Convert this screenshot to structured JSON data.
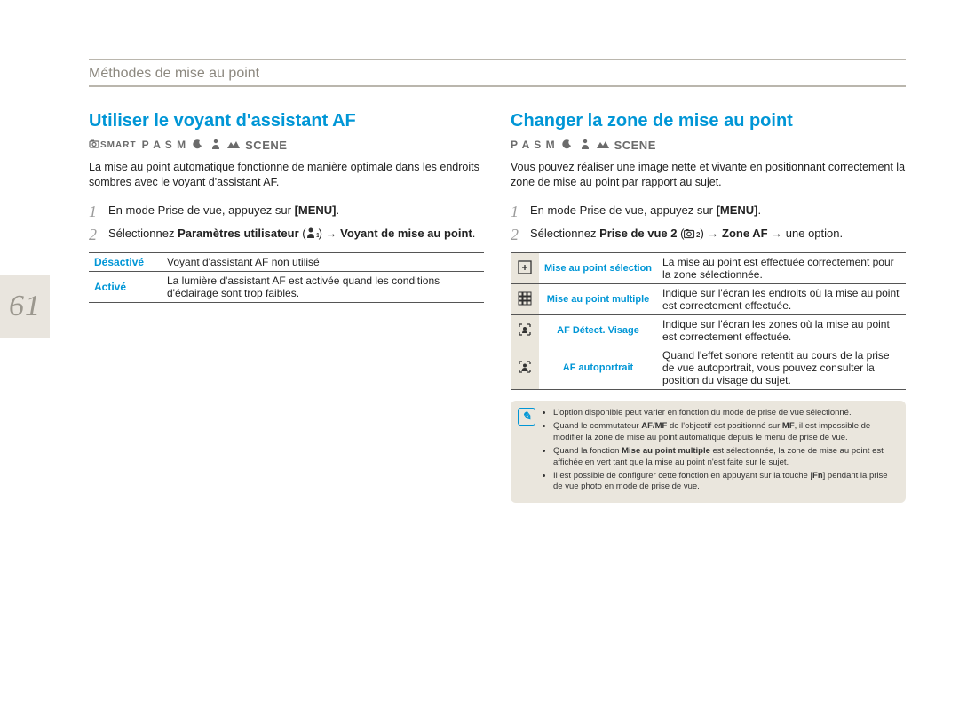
{
  "pageNumber": "61",
  "header": "Méthodes de mise au point",
  "left": {
    "title": "Utiliser le voyant d'assistant AF",
    "modeSmart": "SMART",
    "modePASM": "P A S M",
    "modeScene": "SCENE",
    "intro": "La mise au point automatique fonctionne de manière optimale dans les endroits sombres avec le voyant d'assistant AF.",
    "step1_a": "En mode Prise de vue, appuyez sur ",
    "step1_b": "[MENU]",
    "step1_c": ".",
    "step2_a": "Sélectionnez ",
    "step2_b": "Paramètres utilisateur",
    "step2_c": " (",
    "step2_d": ") → ",
    "step2_e": "Voyant de mise au point",
    "step2_f": ".",
    "opts": {
      "row1_label": "Désactivé",
      "row1_desc": "Voyant d'assistant AF non utilisé",
      "row2_label": "Activé",
      "row2_desc": "La lumière d'assistant AF est activée quand les conditions d'éclairage sont trop faibles."
    }
  },
  "right": {
    "title": "Changer la zone de mise au point",
    "modePASM": "P A S M",
    "modeScene": "SCENE",
    "intro": "Vous pouvez réaliser une image nette et vivante en positionnant correctement la zone de mise au point par rapport au sujet.",
    "step1_a": "En mode Prise de vue, appuyez sur ",
    "step1_b": "[MENU]",
    "step1_c": ".",
    "step2_a": "Sélectionnez ",
    "step2_b": "Prise de vue 2",
    "step2_c": " (",
    "step2_d": ") → ",
    "step2_e": "Zone AF",
    "step2_f": " → une option.",
    "table": {
      "r1_label": "Mise au point sélection",
      "r1_desc": "La mise au point est effectuée correctement pour la zone sélectionnée.",
      "r2_label": "Mise au point multiple",
      "r2_desc": "Indique sur l'écran les endroits où la mise au point est correctement effectuée.",
      "r3_label": "AF Détect. Visage",
      "r3_desc": "Indique sur l'écran les zones où la mise au point est correctement effectuée.",
      "r4_label": "AF autoportrait",
      "r4_desc": "Quand l'effet sonore retentit au cours de la prise de vue autoportrait, vous pouvez consulter la position du visage du sujet."
    },
    "note": {
      "n1": "L'option disponible peut varier en fonction du mode de prise de vue sélectionné.",
      "n2_a": "Quand le commutateur ",
      "n2_b": "AF/MF",
      "n2_c": " de l'objectif est positionné sur ",
      "n2_d": "MF",
      "n2_e": ", il est impossible de modifier la zone de mise au point automatique depuis le menu de prise de vue.",
      "n3_a": "Quand la fonction ",
      "n3_b": "Mise au point multiple",
      "n3_c": " est sélectionnée, la zone de mise au point est affichée en vert tant que la mise au point n'est faite sur le sujet.",
      "n4_a": "Il est possible de configurer cette fonction en appuyant sur la touche [",
      "n4_b": "Fn",
      "n4_c": "] pendant la prise de vue photo en mode de prise de vue."
    }
  }
}
